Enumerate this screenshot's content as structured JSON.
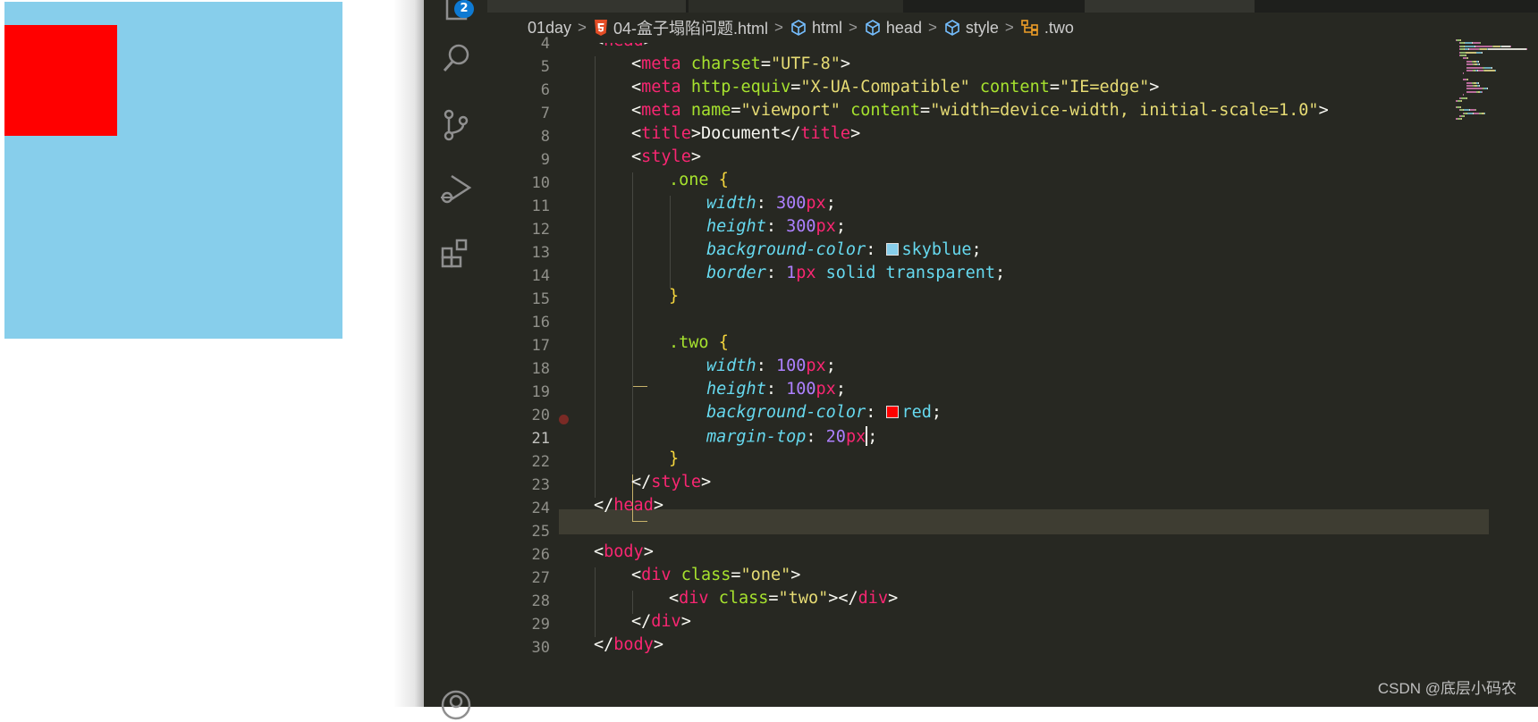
{
  "preview": {
    "outer_color": "#87ceeb",
    "inner_color": "#ff0000"
  },
  "activity_bar": {
    "badge_count": "2",
    "icons": [
      "explorer-icon",
      "search-icon",
      "source-control-icon",
      "run-debug-icon",
      "extensions-icon",
      "account-icon"
    ]
  },
  "breadcrumb": [
    {
      "label": "01day",
      "icon": ""
    },
    {
      "label": "04-盒子塌陷问题.html",
      "icon": "html5-icon"
    },
    {
      "label": "html",
      "icon": "cube-icon"
    },
    {
      "label": "head",
      "icon": "cube-icon"
    },
    {
      "label": "style",
      "icon": "cube-icon"
    },
    {
      "label": ".two",
      "icon": "selector-icon"
    }
  ],
  "editor": {
    "active_line": 21,
    "line_numbers": [
      "4",
      "5",
      "6",
      "7",
      "8",
      "9",
      "10",
      "11",
      "12",
      "13",
      "14",
      "15",
      "16",
      "17",
      "18",
      "19",
      "20",
      "21",
      "22",
      "23",
      "24",
      "25",
      "26",
      "27",
      "28",
      "29",
      "30"
    ],
    "lines": [
      {
        "indent": 0,
        "tokens": [
          [
            "pl",
            "<"
          ],
          [
            "tg",
            "head"
          ],
          [
            "pl",
            ">"
          ]
        ]
      },
      {
        "indent": 1,
        "tokens": [
          [
            "pl",
            "<"
          ],
          [
            "tg",
            "meta"
          ],
          [
            "pl",
            " "
          ],
          [
            "at",
            "charset"
          ],
          [
            "pl",
            "="
          ],
          [
            "st",
            "\"UTF-8\""
          ],
          [
            "pl",
            ">"
          ]
        ]
      },
      {
        "indent": 1,
        "tokens": [
          [
            "pl",
            "<"
          ],
          [
            "tg",
            "meta"
          ],
          [
            "pl",
            " "
          ],
          [
            "at",
            "http-equiv"
          ],
          [
            "pl",
            "="
          ],
          [
            "st",
            "\"X-UA-Compatible\""
          ],
          [
            "pl",
            " "
          ],
          [
            "at",
            "content"
          ],
          [
            "pl",
            "="
          ],
          [
            "st",
            "\"IE=edge\""
          ],
          [
            "pl",
            ">"
          ]
        ]
      },
      {
        "indent": 1,
        "tokens": [
          [
            "pl",
            "<"
          ],
          [
            "tg",
            "meta"
          ],
          [
            "pl",
            " "
          ],
          [
            "at",
            "name"
          ],
          [
            "pl",
            "="
          ],
          [
            "st",
            "\"viewport\""
          ],
          [
            "pl",
            " "
          ],
          [
            "at",
            "content"
          ],
          [
            "pl",
            "="
          ],
          [
            "st",
            "\"width=device-width, initial-scale=1.0\""
          ],
          [
            "pl",
            ">"
          ]
        ]
      },
      {
        "indent": 1,
        "tokens": [
          [
            "pl",
            "<"
          ],
          [
            "tg",
            "title"
          ],
          [
            "pl",
            ">Document</"
          ],
          [
            "tg",
            "title"
          ],
          [
            "pl",
            ">"
          ]
        ]
      },
      {
        "indent": 1,
        "tokens": [
          [
            "pl",
            "<"
          ],
          [
            "tg",
            "style"
          ],
          [
            "pl",
            ">"
          ]
        ]
      },
      {
        "indent": 2,
        "tokens": [
          [
            "sel",
            ".one"
          ],
          [
            "pl",
            " "
          ],
          [
            "br",
            "{"
          ]
        ]
      },
      {
        "indent": 3,
        "tokens": [
          [
            "pr",
            "width"
          ],
          [
            "pl",
            ": "
          ],
          [
            "nu",
            "300"
          ],
          [
            "un",
            "px"
          ],
          [
            "pl",
            ";"
          ]
        ]
      },
      {
        "indent": 3,
        "tokens": [
          [
            "pr",
            "height"
          ],
          [
            "pl",
            ": "
          ],
          [
            "nu",
            "300"
          ],
          [
            "un",
            "px"
          ],
          [
            "pl",
            ";"
          ]
        ]
      },
      {
        "indent": 3,
        "tokens": [
          [
            "pr",
            "background-color"
          ],
          [
            "pl",
            ": "
          ],
          [
            "swatch",
            "#87ceeb"
          ],
          [
            "kw",
            "skyblue"
          ],
          [
            "pl",
            ";"
          ]
        ]
      },
      {
        "indent": 3,
        "tokens": [
          [
            "pr",
            "border"
          ],
          [
            "pl",
            ": "
          ],
          [
            "nu",
            "1"
          ],
          [
            "un",
            "px"
          ],
          [
            "pl",
            " "
          ],
          [
            "kw",
            "solid"
          ],
          [
            "pl",
            " "
          ],
          [
            "kw",
            "transparent"
          ],
          [
            "pl",
            ";"
          ]
        ]
      },
      {
        "indent": 2,
        "tokens": [
          [
            "br",
            "}"
          ]
        ]
      },
      {
        "indent": 0,
        "tokens": []
      },
      {
        "indent": 2,
        "tokens": [
          [
            "sel",
            ".two"
          ],
          [
            "pl",
            " "
          ],
          [
            "br",
            "{"
          ]
        ]
      },
      {
        "indent": 3,
        "tokens": [
          [
            "pr",
            "width"
          ],
          [
            "pl",
            ": "
          ],
          [
            "nu",
            "100"
          ],
          [
            "un",
            "px"
          ],
          [
            "pl",
            ";"
          ]
        ]
      },
      {
        "indent": 3,
        "tokens": [
          [
            "pr",
            "height"
          ],
          [
            "pl",
            ": "
          ],
          [
            "nu",
            "100"
          ],
          [
            "un",
            "px"
          ],
          [
            "pl",
            ";"
          ]
        ]
      },
      {
        "indent": 3,
        "tokens": [
          [
            "pr",
            "background-color"
          ],
          [
            "pl",
            ": "
          ],
          [
            "swatch",
            "#ff0000"
          ],
          [
            "kw",
            "red"
          ],
          [
            "pl",
            ";"
          ]
        ]
      },
      {
        "indent": 3,
        "tokens": [
          [
            "pr",
            "margin-top"
          ],
          [
            "pl",
            ": "
          ],
          [
            "nu",
            "20"
          ],
          [
            "un",
            "px"
          ],
          [
            "cursor",
            ""
          ],
          [
            "pl",
            ";"
          ]
        ]
      },
      {
        "indent": 2,
        "tokens": [
          [
            "br",
            "}"
          ]
        ]
      },
      {
        "indent": 1,
        "tokens": [
          [
            "pl",
            "</"
          ],
          [
            "tg",
            "style"
          ],
          [
            "pl",
            ">"
          ]
        ]
      },
      {
        "indent": 0,
        "tokens": [
          [
            "pl",
            "</"
          ],
          [
            "tg",
            "head"
          ],
          [
            "pl",
            ">"
          ]
        ]
      },
      {
        "indent": 0,
        "tokens": []
      },
      {
        "indent": 0,
        "tokens": [
          [
            "pl",
            "<"
          ],
          [
            "tg",
            "body"
          ],
          [
            "pl",
            ">"
          ]
        ]
      },
      {
        "indent": 1,
        "tokens": [
          [
            "pl",
            "<"
          ],
          [
            "tg",
            "div"
          ],
          [
            "pl",
            " "
          ],
          [
            "at",
            "class"
          ],
          [
            "pl",
            "="
          ],
          [
            "st",
            "\"one\""
          ],
          [
            "pl",
            ">"
          ]
        ]
      },
      {
        "indent": 2,
        "tokens": [
          [
            "pl",
            "<"
          ],
          [
            "tg",
            "div"
          ],
          [
            "pl",
            " "
          ],
          [
            "at",
            "class"
          ],
          [
            "pl",
            "="
          ],
          [
            "st",
            "\"two\""
          ],
          [
            "pl",
            "></"
          ],
          [
            "tg",
            "div"
          ],
          [
            "pl",
            ">"
          ]
        ]
      },
      {
        "indent": 1,
        "tokens": [
          [
            "pl",
            "</"
          ],
          [
            "tg",
            "div"
          ],
          [
            "pl",
            ">"
          ]
        ]
      },
      {
        "indent": 0,
        "tokens": [
          [
            "pl",
            "</"
          ],
          [
            "tg",
            "body"
          ],
          [
            "pl",
            ">"
          ]
        ]
      }
    ]
  },
  "watermark": "CSDN @底层小码农"
}
